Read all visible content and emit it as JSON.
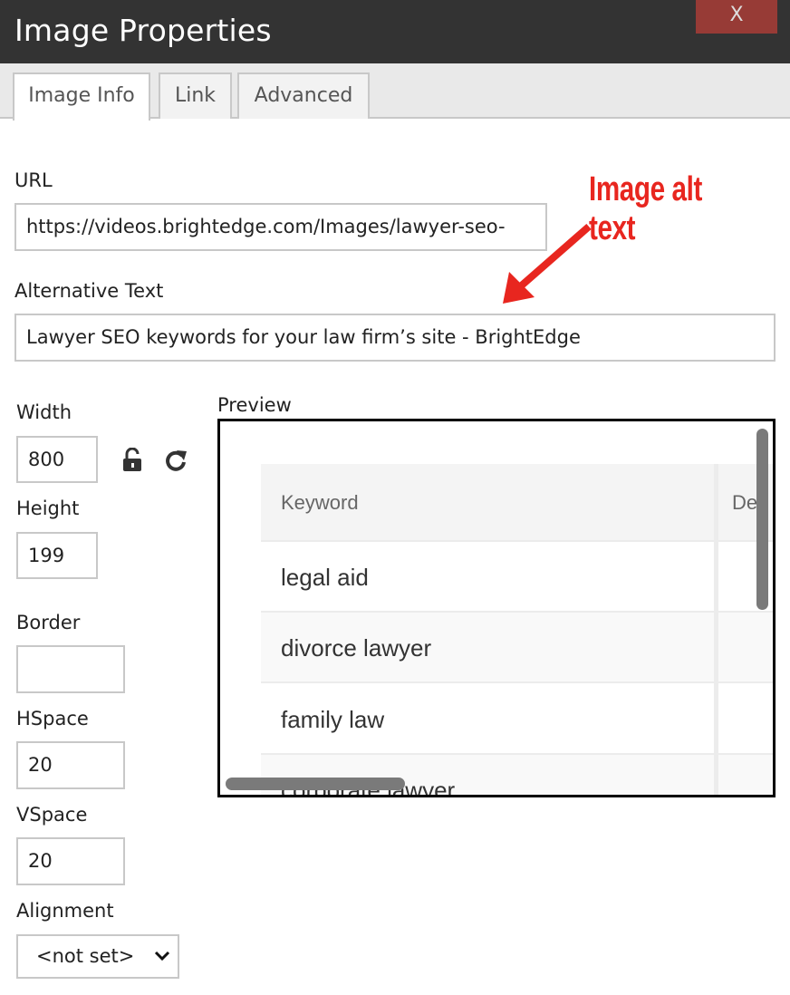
{
  "dialog": {
    "title": "Image Properties",
    "close_label": "X"
  },
  "tabs": [
    {
      "label": "Image Info",
      "active": true
    },
    {
      "label": "Link",
      "active": false
    },
    {
      "label": "Advanced",
      "active": false
    }
  ],
  "form": {
    "url": {
      "label": "URL",
      "value": "https://videos.brightedge.com/Images/lawyer-seo-"
    },
    "alt": {
      "label": "Alternative Text",
      "value": "Lawyer SEO keywords for your law firm’s site - BrightEdge"
    },
    "width": {
      "label": "Width",
      "value": "800"
    },
    "height": {
      "label": "Height",
      "value": "199"
    },
    "border": {
      "label": "Border",
      "value": ""
    },
    "hspace": {
      "label": "HSpace",
      "value": "20"
    },
    "vspace": {
      "label": "VSpace",
      "value": "20"
    },
    "alignment": {
      "label": "Alignment",
      "value": "<not set>"
    },
    "lock_icon": "unlock-icon",
    "reset_icon": "refresh-icon"
  },
  "preview": {
    "label": "Preview",
    "table": {
      "headers": [
        "Keyword",
        "Dec"
      ],
      "rows": [
        "legal aid",
        "divorce lawyer",
        "family law",
        "corporate lawyer"
      ]
    }
  },
  "annotation": {
    "text": "Image alt text",
    "color": "#e8261f"
  }
}
